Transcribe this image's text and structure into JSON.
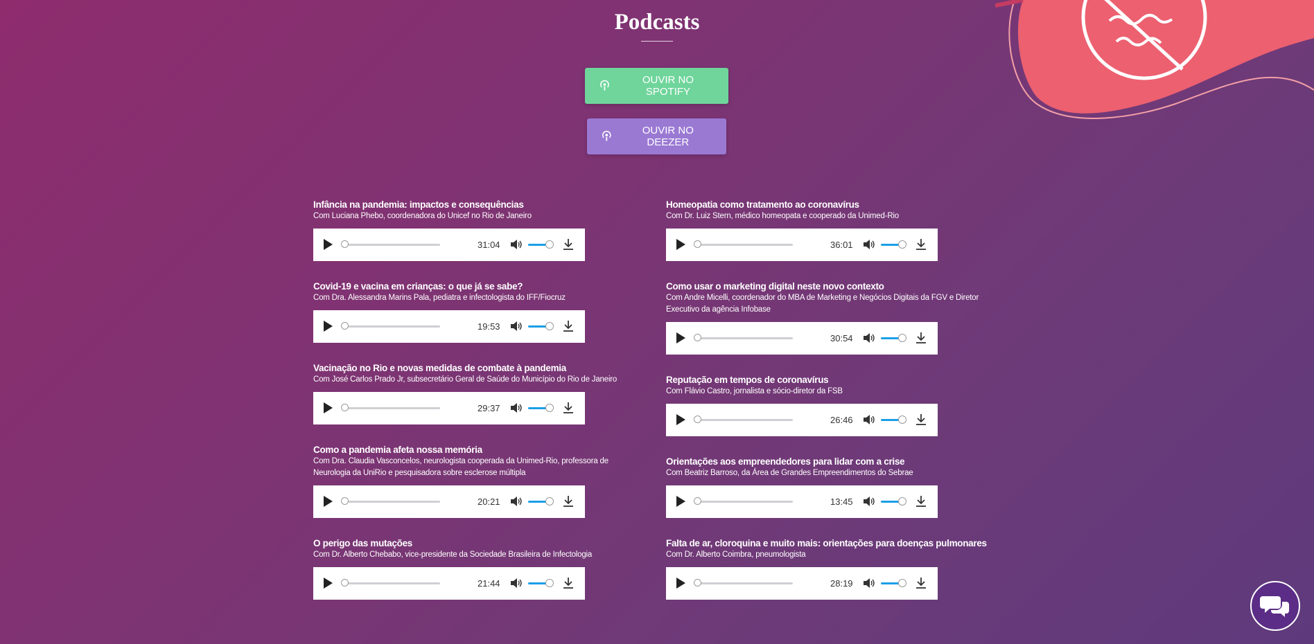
{
  "page": {
    "title": "Podcasts"
  },
  "buttons": {
    "spotify_label": "OUVIR NO SPOTIFY",
    "deezer_label": "OUVIR NO DEEZER",
    "spotify_color": "#6fd59b",
    "deezer_color": "#9a79d3"
  },
  "player_accent": "#1a9fe6",
  "left_episodes": [
    {
      "title": "Infância na pandemia: impactos e consequências",
      "guest": "Com Luciana Phebo, coordenadora do Unicef no Rio de Janeiro",
      "duration": "31:04"
    },
    {
      "title": "Covid-19 e vacina em crianças: o que já se sabe?",
      "guest": "Com Dra. Alessandra Marins Pala, pediatra e infectologista do IFF/Fiocruz",
      "duration": "19:53"
    },
    {
      "title": "Vacinação no Rio e novas medidas de combate à pandemia",
      "guest": "Com José Carlos Prado Jr, subsecretário Geral de Saúde do Município do Rio de Janeiro",
      "duration": "29:37"
    },
    {
      "title": "Como a pandemia afeta nossa memória",
      "guest": "Com Dra. Claudia Vasconcelos, neurologista cooperada da Unimed-Rio, professora de",
      "guest2": "Neurologia da UniRio e pesquisadora sobre esclerose múltipla",
      "duration": "20:21"
    },
    {
      "title": "O perigo das mutações",
      "guest": "Com Dr. Alberto Chebabo, vice-presidente da Sociedade Brasileira de Infectologia",
      "duration": "21:44"
    }
  ],
  "right_episodes": [
    {
      "title": "Homeopatia como tratamento ao coronavírus",
      "guest": "Com Dr. Luiz Stern, médico homeopata e cooperado da Unimed-Rio",
      "duration": "36:01"
    },
    {
      "title": "Como usar o marketing digital neste novo contexto",
      "guest": "Com Andre Micelli, coordenador do MBA de Marketing e Negócios Digitais da FGV e Diretor",
      "guest2": "Executivo da agência Infobase",
      "duration": "30:54"
    },
    {
      "title": "Reputação em tempos de coronavírus",
      "guest": "Com Flávio Castro, jornalista e sócio-diretor da FSB",
      "duration": "26:46"
    },
    {
      "title": "Orientações aos empreendedores para lidar com a crise",
      "guest": "Com Beatriz Barroso, da Área de Grandes Empreendimentos do Sebrae",
      "duration": "13:45"
    },
    {
      "title": "Falta de ar, cloroquina e muito mais: orientações para doenças pulmonares",
      "guest": "Com Dr. Alberto Coimbra, pneumologista",
      "duration": "28:19"
    }
  ],
  "icons": {
    "podcast": "podcast-icon",
    "play": "play-icon",
    "volume": "volume-icon",
    "download": "download-icon",
    "chat": "chat-icon",
    "decoration": "virus-decoration-icon"
  }
}
